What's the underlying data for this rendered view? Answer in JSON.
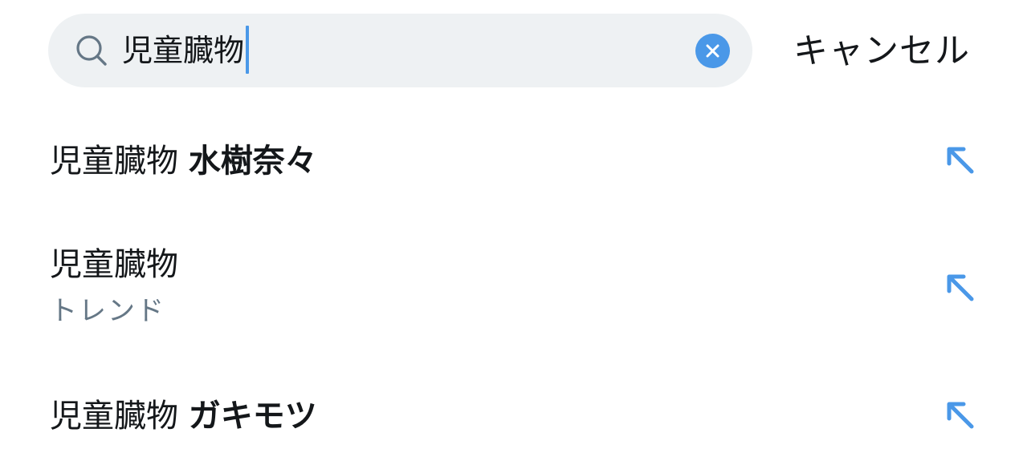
{
  "search": {
    "query": "児童臓物",
    "cancel_label": "キャンセル"
  },
  "suggestions": [
    {
      "prefix": "児童臓物",
      "bold": "水樹奈々",
      "subtitle": ""
    },
    {
      "prefix": "児童臓物",
      "bold": "",
      "subtitle": "トレンド"
    },
    {
      "prefix": "児童臓物",
      "bold": "ガキモツ",
      "subtitle": ""
    }
  ],
  "colors": {
    "accent": "#4a98e8",
    "search_background": "#eef1f3",
    "secondary_text": "#657786",
    "primary_text": "#14171a"
  },
  "icons": {
    "search": "search-icon",
    "clear": "clear-icon",
    "fill_suggestion": "arrow-up-left-icon"
  }
}
